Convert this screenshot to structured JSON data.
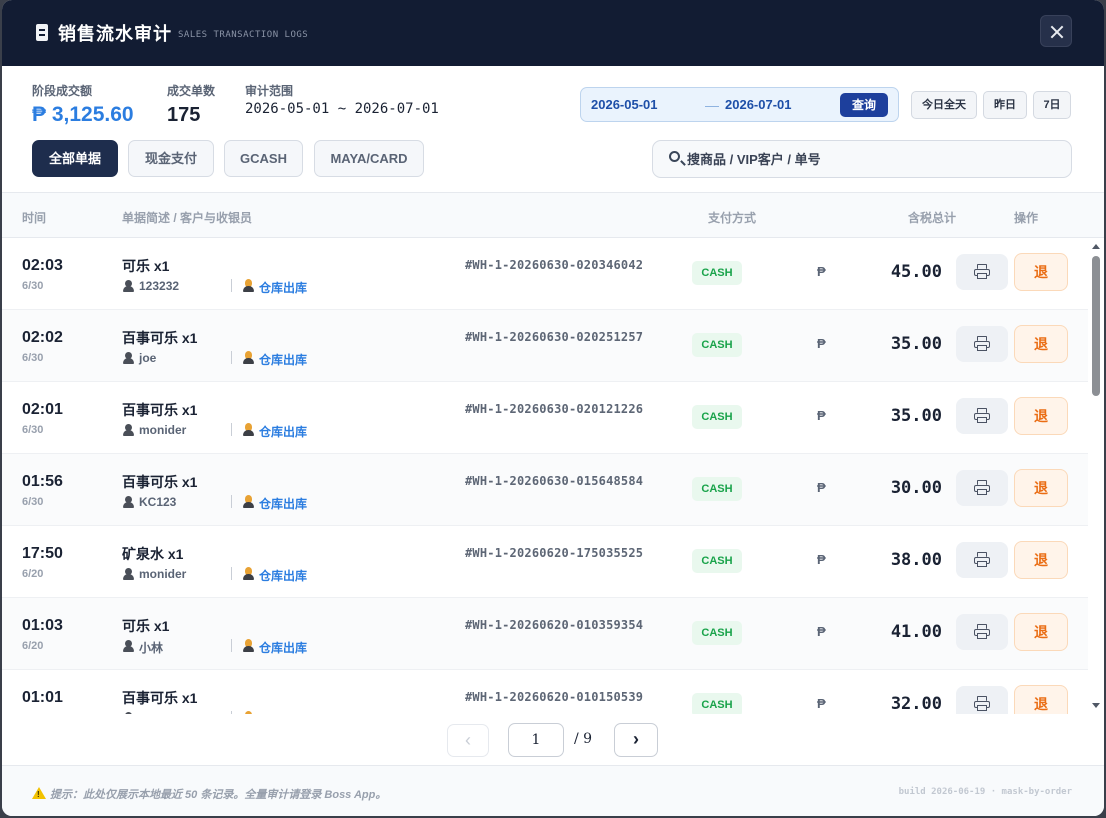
{
  "header": {
    "title": "销售流水审计",
    "subtitle": "SALES TRANSACTION LOGS"
  },
  "stats": {
    "amount_label": "阶段成交额",
    "amount_value": "₱ 3,125.60",
    "count_label": "成交单数",
    "count_value": "175",
    "range_label": "审计范围",
    "range_value": "2026-05-01 ~ 2026-07-01"
  },
  "date_filter": {
    "start": "2026-05-01",
    "end": "2026-07-01",
    "query_label": "查询",
    "quick": [
      "今日全天",
      "昨日",
      "7日"
    ]
  },
  "filters": [
    "全部单据",
    "现金支付",
    "GCASH",
    "MAYA/CARD"
  ],
  "active_filter": "全部单据",
  "search": {
    "placeholder": "搜商品 / VIP客户 / 单号"
  },
  "table": {
    "columns": {
      "time": "时间",
      "desc": "单据简述 / 客户与收银员",
      "payment": "支付方式",
      "total": "含税总计",
      "actions": "操作"
    },
    "currency_symbol": "₱",
    "refund_label": "退",
    "rows": [
      {
        "time": "02:03",
        "date": "6/30",
        "item": "可乐 x1",
        "customer": "123232",
        "cashier": "仓库出库",
        "order": "#WH-1-20260630-020346042",
        "payment": "CASH",
        "total": "45.00"
      },
      {
        "time": "02:02",
        "date": "6/30",
        "item": "百事可乐 x1",
        "customer": "joe",
        "cashier": "仓库出库",
        "order": "#WH-1-20260630-020251257",
        "payment": "CASH",
        "total": "35.00"
      },
      {
        "time": "02:01",
        "date": "6/30",
        "item": "百事可乐 x1",
        "customer": "monider",
        "cashier": "仓库出库",
        "order": "#WH-1-20260630-020121226",
        "payment": "CASH",
        "total": "35.00"
      },
      {
        "time": "01:56",
        "date": "6/30",
        "item": "百事可乐 x1",
        "customer": "KC123",
        "cashier": "仓库出库",
        "order": "#WH-1-20260630-015648584",
        "payment": "CASH",
        "total": "30.00"
      },
      {
        "time": "17:50",
        "date": "6/20",
        "item": "矿泉水 x1",
        "customer": "monider",
        "cashier": "仓库出库",
        "order": "#WH-1-20260620-175035525",
        "payment": "CASH",
        "total": "38.00"
      },
      {
        "time": "01:03",
        "date": "6/20",
        "item": "可乐 x1",
        "customer": "小林",
        "cashier": "仓库出库",
        "order": "#WH-1-20260620-010359354",
        "payment": "CASH",
        "total": "41.00"
      },
      {
        "time": "01:01",
        "date": "",
        "item": "百事可乐 x1",
        "customer": "",
        "cashier": "",
        "order": "#WH-1-20260620-010150539",
        "payment": "CASH",
        "total": "32.00"
      }
    ]
  },
  "pager": {
    "prev": "‹",
    "current": "1",
    "total": "/ 9",
    "next": "›"
  },
  "footer": {
    "notice": "提示：此处仅展示本地最近 50 条记录。全量审计请登录 Boss App。",
    "build": "build 2026-06-19 · mask-by-order"
  },
  "colors": {
    "header_bg": "#121c33",
    "accent_blue": "#2b7de0",
    "cash_green": "#19a34a",
    "refund_orange": "#ea6d14"
  }
}
